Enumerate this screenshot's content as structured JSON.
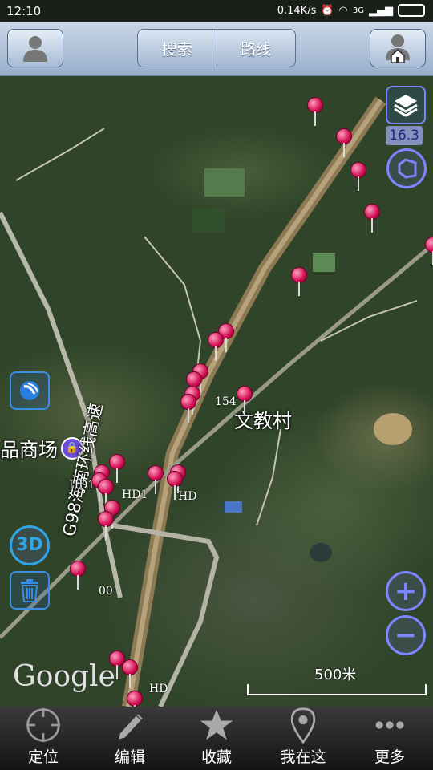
{
  "status_bar": {
    "time": "12:10",
    "speed": "0.14K/s",
    "network": "3G"
  },
  "top_bar": {
    "search_label": "搜索",
    "route_label": "路线"
  },
  "map": {
    "zoom_level": "16.3",
    "labels": {
      "village": "文教村",
      "mall": "品商场",
      "highway": "G98海南环线高速",
      "num_154": "154",
      "hd1_a": "HD1",
      "hd1_b": "HD1",
      "hd_a": "HD",
      "hd_b": "HD",
      "zero": "00"
    },
    "watermark": "Google",
    "scale": "500米",
    "pin_count": 26
  },
  "side_buttons": {
    "three_d_label": "3D"
  },
  "zoom_controls": {
    "zoom_in": "+",
    "zoom_out": "−"
  },
  "bottom_tabs": [
    {
      "label": "定位",
      "icon": "crosshair-icon"
    },
    {
      "label": "编辑",
      "icon": "pencil-icon"
    },
    {
      "label": "收藏",
      "icon": "star-icon"
    },
    {
      "label": "我在这",
      "icon": "location-pin-icon"
    },
    {
      "label": "更多",
      "icon": "more-dots-icon"
    }
  ],
  "colors": {
    "pin": "#d10c52",
    "map_control": "#7d86ff",
    "side_button": "#3b8ee6"
  }
}
